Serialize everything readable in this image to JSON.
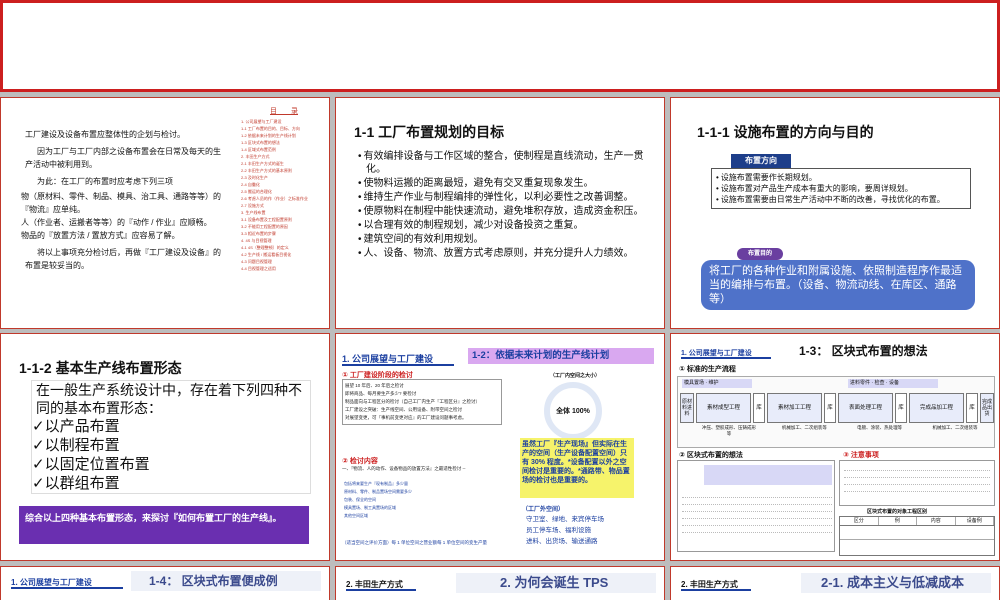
{
  "s1": {
    "paras": [
      "工厂建设及设备布置应整体性的企划与检讨。",
      "因为工厂与工厂内部之设备布置会在日常及每天的生产活动中被利用到。",
      "为此：在工厂的布置时应考虑下列三项",
      "物（原材料、零件、制品、模具、治工具、通路等等）的『物流』应单纯。",
      "人（作业者、运搬者等等）的『动作 / 作业』应顺畅。",
      "物品的『放置方法 / 置放方式』应容易了解。",
      "将以上事项充分检讨后，再做『工厂建设及设备』的布置是较妥当的。"
    ],
    "toc_title": "目　　录",
    "toc": [
      "1. 公司展望与工厂建设",
      "1-1 工厂布置的目的、目标、方向",
      "1-2 依据未来计划的生产线计划",
      "1-3 区块式布置的想法",
      "1-4 区域式布置范例",
      "2. 丰田生产方式",
      "2-1 丰田生产方式的诞生",
      "2-2 丰田生产方式的基本原则",
      "2-3 及时化生产",
      "2-4 自働化",
      "2-5 搬运的合理化",
      "2-6 考虑人员的作（作业）之标准作业",
      "2-7 设施方式",
      "3. 生产线布置",
      "3-1 设备布置及工程配置原则",
      "3-2 不能用工程配置的原因",
      "3-3 相近布置的步骤",
      "4. 4S 与目视管理",
      "4-1 4S（整理整顿）的定义",
      "4-2 生产线 / 搬运看板目视化",
      "4-3 问题目视管理",
      "4-4 目视管理之适用"
    ]
  },
  "s2": {
    "title": "1-1 工厂布置规划的目标",
    "bullets": [
      "有效编排设备与工作区域的整合，使制程是直线流动，生产一贯化。",
      "使物料运搬的距离最短，避免有交叉重复现象发生。",
      "维持生产作业与制程编排的弹性化，以利必要性之改善调整。",
      "使原物料在制程中能快速流动，避免堆积存放，造成资金积压。",
      "以合理有效的制程规划，减少对设备投资之重复。",
      "建筑空间的有效利用规划。",
      "人、设备、物流、放置方式考虑原则，并充分提升人力绩效。"
    ]
  },
  "s3": {
    "title": "1-1-1 设施布置的方向与目的",
    "dir_label": "布置方向",
    "dir_items": [
      "设施布置需要作长期规划。",
      "设施布置对产品生产成本有重大的影响，要周详规划。",
      "设施布置需要由日常生产活动中不断的改善，寻找优化的布置。"
    ],
    "goal_label": "布置目的",
    "goal_text": "将工厂的各种作业和附属设施、依照制造程序作最适当的编排与布置。（设备、物流动线、在库区、通路等）"
  },
  "s4": {
    "title": "1-1-2 基本生产线布置形态",
    "intro": "在一般生产系统设计中，存在着下列四种不同的基本布置形态：",
    "forms": [
      "以产品布置",
      "以制程布置",
      "以固定位置布置",
      "以群组布置"
    ],
    "summary": "综合以上四种基本布置形态，来探讨『如何布置工厂的生产线』。"
  },
  "s5": {
    "section": "1. 公司展望与工厂建设",
    "title": "1-2：依据未来计划的生产线计划",
    "h_check": "① 工厂建设阶段的检讨",
    "checks": [
      "展望 10 年后、20 年后之检讨",
      "即将商品、每月要生产多少? 要检讨",
      "制品面向与工程区分的检讨（自己工厂内生产『工程区分』之检讨）",
      "工厂建设之突破：生产线空间、公用设备、附带空间之检讨",
      "对展望变更，可『事机前变更对应』的工厂建设问题事考虑。"
    ],
    "circle_caption": "（工厂内空间之大小）",
    "circle_label": "全体 100%",
    "note": "虽然工厂『生产现场』但实际在生产的空间（生产设备配置空间）只有 30% 程度。*设备配置以外之空间检讨是重要的。*通路带、物品置场的检讨也是重要的。",
    "h_content": "② 检讨内容",
    "content_lead": "一、『物流、人的动作、设备物品的放置方法』之最适性检讨 --",
    "content_rows": [
      "包括将来要生产『现有制品』多少量",
      "原材料、零件、制品置场空间需要多少",
      "包装、保全的空间",
      "模具置场、制工具置场的区域",
      "其他空间区域"
    ],
    "outside_title": "（工厂外空间）",
    "outside": [
      "守卫室、绿地、来宾停车场",
      "员工停车场、福利设施",
      "进料、出货场、输送通路"
    ],
    "footer": "（适当空间之评价方面）每 1 单位空间之营业额每 1 单位空间的变生产量"
  },
  "s6": {
    "section": "1. 公司展望与工厂建设",
    "title": "1-3： 区块式布置的想法",
    "h_flow": "① 标准的生产流程",
    "flow_top": [
      "模具置场",
      "维护"
    ],
    "flow_top2": [
      "进料零件",
      "检查",
      "设备"
    ],
    "flow": [
      "原材料进料",
      "素材成型工程",
      "库",
      "素材加工工程",
      "库",
      "表面处理工程",
      "库",
      "完成品加工程",
      "库",
      "完成品出货"
    ],
    "flow_sub": [
      "冲压、塑胶成形、压铸成形等",
      "机械加工、二次组装等",
      "电镀、涂装、热处理等",
      "机械加工、二次组装等"
    ],
    "h_block": "② 区块式布置的想法",
    "h_notes": "③ 注意事项",
    "table_title": "区块式布置的对象工程区别",
    "table_headers": [
      "区分",
      "例",
      "内容",
      "设备例"
    ]
  },
  "s7": {
    "section": "1. 公司展望与工厂建设",
    "title": "1-4： 区块式布置便成例"
  },
  "s8": {
    "section": "2. 丰田生产方式",
    "title": "2. 为何会诞生 TPS"
  },
  "s9": {
    "section": "2. 丰田生产方式",
    "title": "2-1. 成本主义与低减成本"
  }
}
